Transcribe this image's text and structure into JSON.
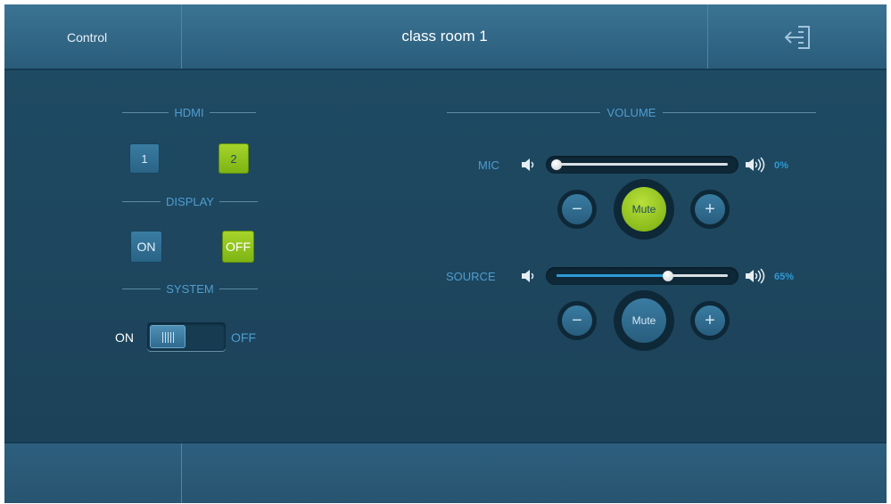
{
  "header": {
    "left_label": "Control",
    "title": "class room 1",
    "exit_icon": "exit-door-icon"
  },
  "left_panel": {
    "hdmi": {
      "heading": "HDMI",
      "buttons": [
        {
          "label": "1",
          "selected": false
        },
        {
          "label": "2",
          "selected": true
        }
      ]
    },
    "display": {
      "heading": "DISPLAY",
      "buttons": [
        {
          "label": "ON",
          "selected": false
        },
        {
          "label": "OFF",
          "selected": true
        }
      ]
    },
    "system": {
      "heading": "SYSTEM",
      "on_label": "ON",
      "off_label": "OFF",
      "state": "ON"
    }
  },
  "volume": {
    "heading": "VOLUME",
    "mic": {
      "label": "MIC",
      "level_text": "0%",
      "level": 0,
      "minus_label": "−",
      "plus_label": "+",
      "mute_label": "Mute",
      "muted": true
    },
    "source": {
      "label": "SOURCE",
      "level_text": "65%",
      "level": 65,
      "minus_label": "−",
      "plus_label": "+",
      "mute_label": "Mute",
      "muted": false
    }
  },
  "colors": {
    "accent_blue": "#2e9ad6",
    "active_green": "#8cc418",
    "panel_bg": "#1e4760",
    "header_bg": "#326a8a"
  }
}
